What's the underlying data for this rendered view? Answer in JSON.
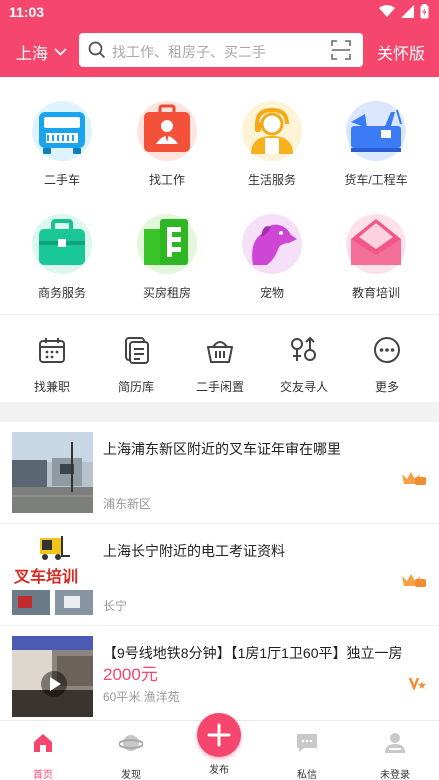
{
  "status": {
    "time": "11:03"
  },
  "header": {
    "city": "上海",
    "search_placeholder": "找工作、租房子、买二手",
    "care_mode": "关怀版"
  },
  "categories": [
    {
      "label": "二手车",
      "icon": "bus-icon"
    },
    {
      "label": "找工作",
      "icon": "briefcase-icon"
    },
    {
      "label": "生活服务",
      "icon": "worker-icon"
    },
    {
      "label": "货车/工程车",
      "icon": "truck-icon"
    },
    {
      "label": "商务服务",
      "icon": "business-bag-icon"
    },
    {
      "label": "买房租房",
      "icon": "building-icon"
    },
    {
      "label": "宠物",
      "icon": "dog-icon"
    },
    {
      "label": "教育培训",
      "icon": "envelope-icon"
    }
  ],
  "tools": [
    {
      "label": "找兼职",
      "icon": "calendar-icon"
    },
    {
      "label": "简历库",
      "icon": "resume-icon"
    },
    {
      "label": "二手闲置",
      "icon": "basket-icon"
    },
    {
      "label": "交友寻人",
      "icon": "gender-icon"
    },
    {
      "label": "更多",
      "icon": "more-icon"
    }
  ],
  "listings": [
    {
      "title": "上海浦东新区附近的叉车证年审在哪里",
      "location": "浦东新区"
    },
    {
      "title": "上海长宁附近的电工考证资料",
      "location": "长宁",
      "thumb_text": "叉车培训"
    },
    {
      "title": "【9号线地铁8分钟】【1房1厅1卫60平】独立一房",
      "price": "2000元",
      "sub": "60平米  渔洋苑"
    }
  ],
  "bottom_nav": [
    {
      "label": "首页",
      "icon": "home-icon",
      "active": true
    },
    {
      "label": "发现",
      "icon": "planet-icon"
    },
    {
      "label": "发布",
      "icon": "plus-icon"
    },
    {
      "label": "私信",
      "icon": "chat-icon"
    },
    {
      "label": "未登录",
      "icon": "user-icon"
    }
  ],
  "colors": {
    "brand": "#f5476d",
    "active_nav": "#f5476d"
  }
}
